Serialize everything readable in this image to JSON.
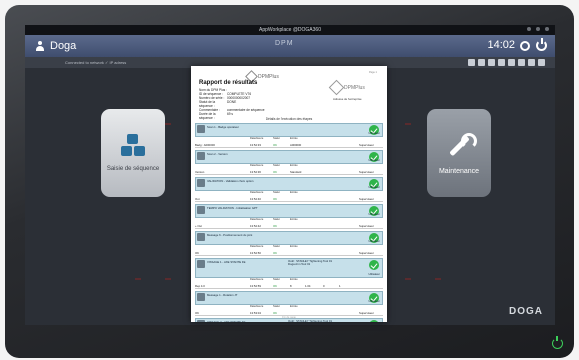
{
  "window": {
    "title": "AppWorkplace @DOGA360"
  },
  "appbar": {
    "user": "Doga",
    "brand": "DPM",
    "time": "14:02"
  },
  "toolbar": {
    "text": "Connected to network  ✓  IP adress"
  },
  "tiles": {
    "left": {
      "label": "Saisie de séquence",
      "icon": "cubes-icon"
    },
    "right": {
      "label": "Maintenance",
      "icon": "wrench-icon"
    }
  },
  "brand_logo": "DOGA",
  "report": {
    "title": "Rapport de résultats",
    "logo": "DPMPlus",
    "logo2": "DPMPlus",
    "small": "Page 1",
    "address": "Adresse de l'entreprise",
    "meta": [
      {
        "k": "Nom du DPM Plus :",
        "v": ""
      },
      {
        "k": "ID de séquence :",
        "v": "COMPLETE V76"
      },
      {
        "k": "Numéro de série :",
        "v": "0000000002007"
      },
      {
        "k": "Statut de la séquence :",
        "v": "DONE"
      },
      {
        "k": "Commentaire :",
        "v": "commentaire de séquence"
      },
      {
        "k": "Durée de la séquence :",
        "v": "69 s"
      }
    ],
    "steps_title": "Détails de l'exécution des étapes",
    "cols": {
      "date": "Date/Heure",
      "statut": "Statut",
      "entree": "Entrée"
    },
    "steps": [
      {
        "name": "Scan 1 - Badge opérateur",
        "user": "Utilisateur",
        "row": [
          "Badg : A000000",
          "13:52:33",
          "OK",
          "A000000",
          "Superviseur"
        ]
      },
      {
        "name": "Scan 2 - Version",
        "user": "Utilisateur",
        "row": [
          "Version",
          "13:52:36",
          "OK",
          "Standard",
          "Superviseur"
        ]
      },
      {
        "name": "VALIDATION - Validation choix option",
        "user": "Utilisateur",
        "row": [
          "Out",
          "13:52:40",
          "OK",
          "",
          "Superviseur"
        ]
      },
      {
        "name": "TEMPO VALIDATION - Initialisation GPT",
        "user": "Utilisateur",
        "row": [
          "+ Out",
          "13:52:42",
          "OK",
          "",
          "Superviseur"
        ]
      },
      {
        "name": "Message 6 - Positionnement du joint",
        "user": "Utilisateur",
        "row": [
          "OK",
          "13:52:50",
          "OK",
          "",
          "Superviseur"
        ]
      },
      {
        "name": "VISSAGE 1 - AXE STANTE FE",
        "extra": [
          "Outil : STANLEY Tightening Tool 01",
          "Doga Arm Tool 01"
        ],
        "user": "Utilisateur",
        "row": [
          "Rep 4.0",
          "13:52:59",
          "OK",
          "8",
          "1.04",
          "0",
          "1"
        ]
      },
      {
        "name": "Message 1 - Rotation JT",
        "user": "Utilisateur",
        "row": [
          "OK",
          "13:53:04",
          "OK",
          "",
          "Superviseur"
        ]
      },
      {
        "name": "VISSAGE 2 - AXE STANTE FE",
        "extra": [
          "Outil : STANLEY Tightening Tool 01",
          "Doga Arm Tool 01"
        ],
        "user": "Utilisateur",
        "row": [
          "Rep 4.0",
          "13:53:12",
          "OK",
          "8",
          "1.04",
          "0",
          "1"
        ]
      }
    ],
    "footer": "Fin de page"
  }
}
